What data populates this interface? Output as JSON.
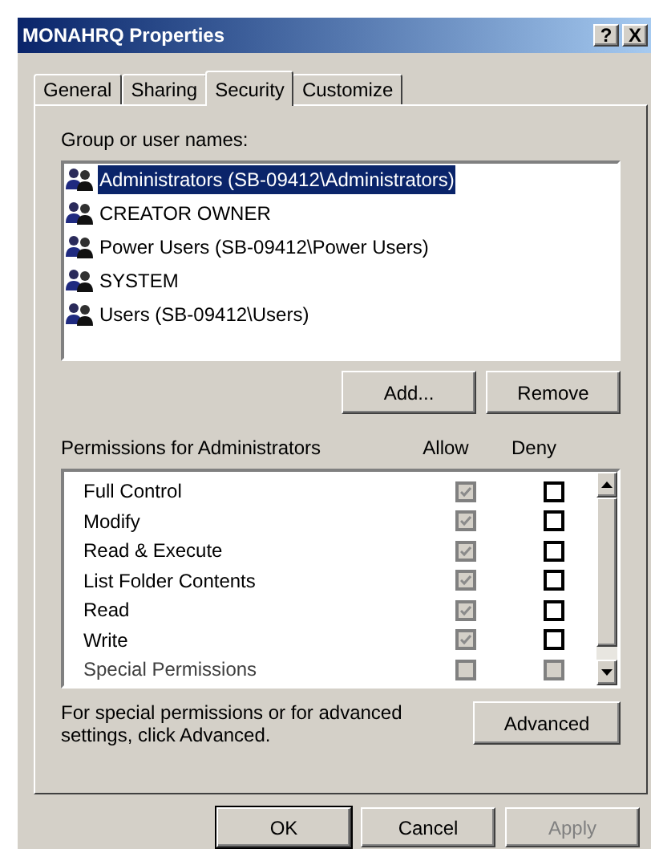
{
  "window": {
    "title": "MONAHRQ Properties",
    "help_button": "?",
    "close_button": "X"
  },
  "tabs": [
    {
      "label": "General",
      "selected": false
    },
    {
      "label": "Sharing",
      "selected": false
    },
    {
      "label": "Security",
      "selected": true
    },
    {
      "label": "Customize",
      "selected": false
    }
  ],
  "group_label": "Group or user names:",
  "users": [
    {
      "name": "Administrators (SB-09412\\Administrators)",
      "selected": true
    },
    {
      "name": "CREATOR OWNER",
      "selected": false
    },
    {
      "name": "Power Users (SB-09412\\Power Users)",
      "selected": false
    },
    {
      "name": "SYSTEM",
      "selected": false
    },
    {
      "name": "Users (SB-09412\\Users)",
      "selected": false
    }
  ],
  "user_buttons": [
    "Add...",
    "Remove"
  ],
  "permissions_header": {
    "title": "Permissions for Administrators",
    "allow": "Allow",
    "deny": "Deny"
  },
  "permissions": [
    {
      "name": "Full Control",
      "allow": {
        "checked": true,
        "disabled": true
      },
      "deny": {
        "checked": false,
        "disabled": false
      }
    },
    {
      "name": "Modify",
      "allow": {
        "checked": true,
        "disabled": true
      },
      "deny": {
        "checked": false,
        "disabled": false
      }
    },
    {
      "name": "Read & Execute",
      "allow": {
        "checked": true,
        "disabled": true
      },
      "deny": {
        "checked": false,
        "disabled": false
      }
    },
    {
      "name": "List Folder Contents",
      "allow": {
        "checked": true,
        "disabled": true
      },
      "deny": {
        "checked": false,
        "disabled": false
      }
    },
    {
      "name": "Read",
      "allow": {
        "checked": true,
        "disabled": true
      },
      "deny": {
        "checked": false,
        "disabled": false
      }
    },
    {
      "name": "Write",
      "allow": {
        "checked": true,
        "disabled": true
      },
      "deny": {
        "checked": false,
        "disabled": false
      }
    },
    {
      "name": "Special Permissions",
      "allow": {
        "checked": false,
        "disabled": true
      },
      "deny": {
        "checked": false,
        "disabled": true
      }
    }
  ],
  "advanced_note": "For special permissions or for advanced settings, click Advanced.",
  "advanced_button": "Advanced",
  "dialog_buttons": [
    {
      "label": "OK",
      "disabled": false,
      "default": true
    },
    {
      "label": "Cancel",
      "disabled": false,
      "default": false
    },
    {
      "label": "Apply",
      "disabled": true,
      "default": false
    }
  ]
}
